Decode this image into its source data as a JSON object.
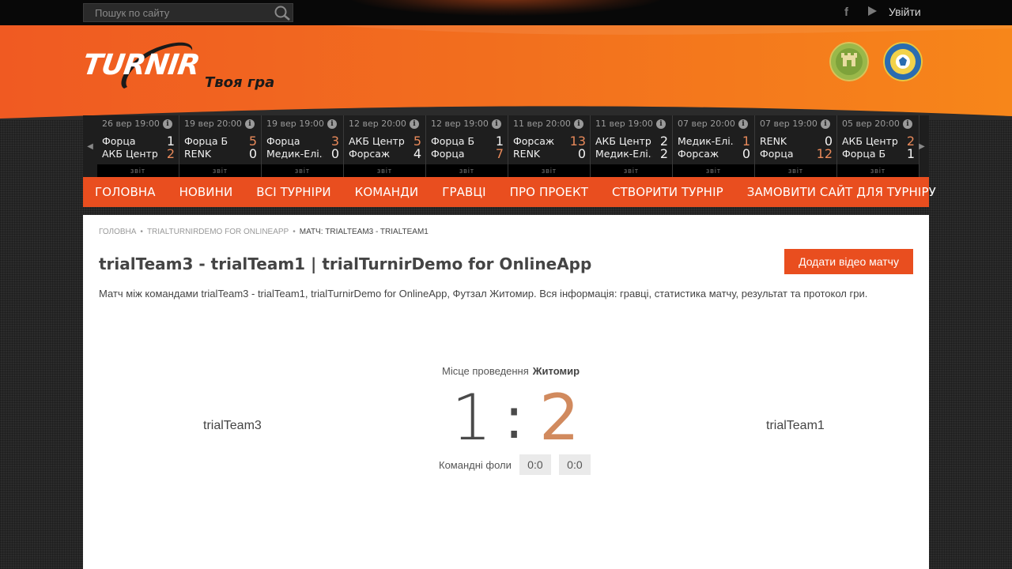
{
  "topbar": {
    "search_placeholder": "Пошук по сайту",
    "login_label": "Увійти",
    "facebook_glyph": "f"
  },
  "header": {
    "logo_text": "TURNIR",
    "slogan": "Твоя гра"
  },
  "matches": [
    {
      "date": "26 вер 19:00",
      "home": "Форца",
      "home_score": "1",
      "away": "АКБ Центр",
      "away_score": "2",
      "report": "звіт",
      "winner": "away"
    },
    {
      "date": "19 вер 20:00",
      "home": "Форца Б",
      "home_score": "5",
      "away": "RENK",
      "away_score": "0",
      "report": "звіт",
      "winner": "home"
    },
    {
      "date": "19 вер 19:00",
      "home": "Форца",
      "home_score": "3",
      "away": "Медик-Елі..",
      "away_score": "0",
      "report": "звіт",
      "winner": "home"
    },
    {
      "date": "12 вер 20:00",
      "home": "АКБ Центр",
      "home_score": "5",
      "away": "Форсаж",
      "away_score": "4",
      "report": "звіт",
      "winner": "home"
    },
    {
      "date": "12 вер 19:00",
      "home": "Форца Б",
      "home_score": "1",
      "away": "Форца",
      "away_score": "7",
      "report": "звіт",
      "winner": "away"
    },
    {
      "date": "11 вер 20:00",
      "home": "Форсаж",
      "home_score": "13",
      "away": "RENK",
      "away_score": "0",
      "report": "звіт",
      "winner": "home"
    },
    {
      "date": "11 вер 19:00",
      "home": "АКБ Центр",
      "home_score": "2",
      "away": "Медик-Елі..",
      "away_score": "2",
      "report": "звіт",
      "winner": "none"
    },
    {
      "date": "07 вер 20:00",
      "home": "Медик-Елі..",
      "home_score": "1",
      "away": "Форсаж",
      "away_score": "0",
      "report": "звіт",
      "winner": "home"
    },
    {
      "date": "07 вер 19:00",
      "home": "RENK",
      "home_score": "0",
      "away": "Форца",
      "away_score": "12",
      "report": "звіт",
      "winner": "away"
    },
    {
      "date": "05 вер 20:00",
      "home": "АКБ Центр",
      "home_score": "2",
      "away": "Форца Б",
      "away_score": "1",
      "report": "звіт",
      "winner": "home"
    }
  ],
  "nav": [
    "ГОЛОВНА",
    "НОВИНИ",
    "ВСІ ТУРНІРИ",
    "КОМАНДИ",
    "ГРАВЦІ",
    "ПРО ПРОЕКТ",
    "СТВОРИТИ ТУРНІР",
    "ЗАМОВИТИ САЙТ ДЛЯ ТУРНІРУ"
  ],
  "breadcrumb": {
    "items": [
      "ГОЛОВНА",
      "TRIALTURNIRDEMO FOR ONLINEAPP"
    ],
    "current": "МАТЧ: TRIALTEAM3 - TRIALTEAM1"
  },
  "page": {
    "title": "trialTeam3 - trialTeam1 | trialTurnirDemo for OnlineApp",
    "add_video_label": "Додати відео матчу",
    "description": "Матч між командами trialTeam3 - trialTeam1, trialTurnirDemo for OnlineApp, Футзал Житомир. Вся інформація: гравці, статистика матчу, результат та протокол гри."
  },
  "match": {
    "venue_label": "Місце проведення",
    "venue": "Житомир",
    "home_team": "trialTeam3",
    "away_team": "trialTeam1",
    "home_score": "1",
    "separator": ":",
    "away_score": "2",
    "fouls_label": "Командні фоли",
    "home_fouls": "0:0",
    "away_fouls": "0:0"
  },
  "colors": {
    "accent": "#e94e1f",
    "win_score": "#e8895a",
    "away_score_big": "#d18a5e"
  }
}
